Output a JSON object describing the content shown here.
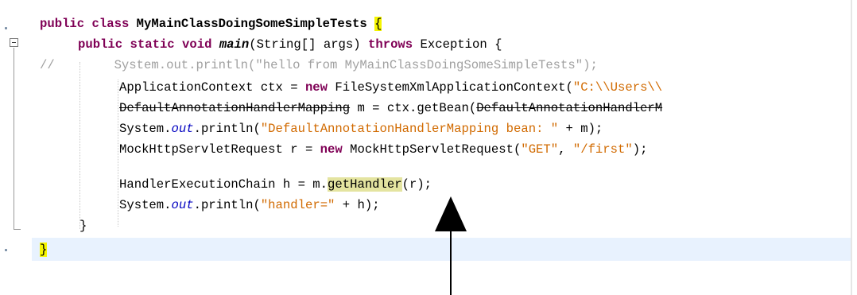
{
  "editor": {
    "lines": {
      "l1": {
        "kw1": "public",
        "kw2": "class",
        "name": "MyMainClassDoingSomeSimpleTests",
        "brace": "{"
      },
      "l2": {
        "kw1": "public",
        "kw2": "static",
        "kw3": "void",
        "method": "main",
        "params": "(String[] args)",
        "kw4": "throws",
        "tail": "Exception {"
      },
      "l3": {
        "comment": "//        System.out.println(\"hello from MyMainClassDoingSomeSimpleTests\");"
      },
      "l4": {
        "pre": "ApplicationContext ctx = ",
        "kw": "new",
        "mid": " FileSystemXmlApplicationContext(",
        "str": "\"C:\\\\Users\\\\"
      },
      "l5": {
        "strike1": "DefaultAnnotationHandlerMapping",
        "mid": " m = ctx.getBean(",
        "strike2": "DefaultAnnotationHandlerM"
      },
      "l6": {
        "pre": "System.",
        "field": "out",
        "mid": ".println(",
        "str": "\"DefaultAnnotationHandlerMapping bean: \"",
        "tail": " + m);"
      },
      "l7": {
        "pre": "MockHttpServletRequest r = ",
        "kw": "new",
        "mid": " MockHttpServletRequest(",
        "str1": "\"GET\"",
        "sep": ", ",
        "str2": "\"/first\"",
        "tail": ");"
      },
      "l8": {
        "pre": "HandlerExecutionChain h = m.",
        "method": "getHandler",
        "tail": "(r);"
      },
      "l9": {
        "pre": "System.",
        "field": "out",
        "mid": ".println(",
        "str": "\"handler=\"",
        "tail": " + h);"
      },
      "l10": {
        "brace": "}"
      },
      "l11": {
        "brace": "}"
      }
    }
  }
}
